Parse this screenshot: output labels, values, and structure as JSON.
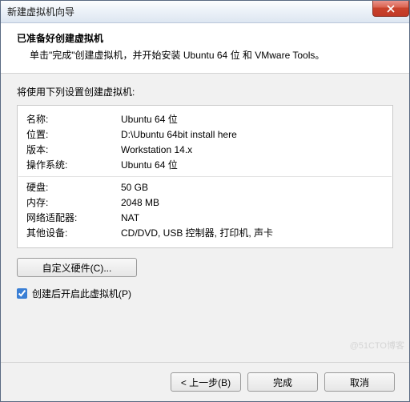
{
  "window": {
    "title": "新建虚拟机向导"
  },
  "header": {
    "title": "已准备好创建虚拟机",
    "subtitle": "单击\"完成\"创建虚拟机，并开始安装 Ubuntu 64 位 和 VMware Tools。"
  },
  "body": {
    "lead": "将使用下列设置创建虚拟机:",
    "rows1": [
      {
        "label": "名称:",
        "value": "Ubuntu 64 位"
      },
      {
        "label": "位置:",
        "value": "D:\\Ubuntu 64bit install here"
      },
      {
        "label": "版本:",
        "value": "Workstation 14.x"
      },
      {
        "label": "操作系统:",
        "value": "Ubuntu 64 位"
      }
    ],
    "rows2": [
      {
        "label": "硬盘:",
        "value": "50 GB"
      },
      {
        "label": "内存:",
        "value": "2048 MB"
      },
      {
        "label": "网络适配器:",
        "value": "NAT"
      },
      {
        "label": "其他设备:",
        "value": "CD/DVD, USB 控制器, 打印机, 声卡"
      }
    ],
    "custom_button": "自定义硬件(C)...",
    "checkbox_label": "创建后开启此虚拟机(P)",
    "checkbox_checked": true
  },
  "footer": {
    "back": "< 上一步(B)",
    "finish": "完成",
    "cancel": "取消"
  },
  "watermark": "@51CTO博客"
}
